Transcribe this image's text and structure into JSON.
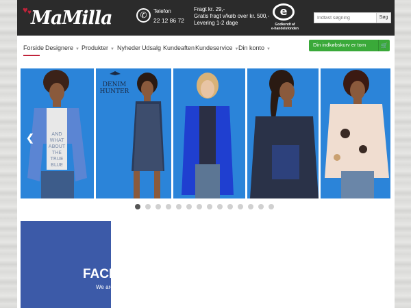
{
  "brand": {
    "name": "MaMilla"
  },
  "contact": {
    "phone_label": "Telefon",
    "phone_number": "22 12 86 72"
  },
  "shipping": {
    "line1": "Fragt kr. 29,-",
    "line2": "Gratis fragt v/køb over kr. 500,-",
    "line3": "Levering 1-2 dage"
  },
  "emaerke": {
    "letter": "e",
    "line1": "Godkendt af",
    "line2": "e-handelsfonden"
  },
  "search": {
    "placeholder": "Indtast søgning",
    "button_label": "Søg"
  },
  "nav": {
    "items": [
      {
        "label": "Forside",
        "dropdown": false
      },
      {
        "label": "Designere",
        "dropdown": true
      },
      {
        "label": "Produkter",
        "dropdown": true
      },
      {
        "label": "Nyheder",
        "dropdown": false
      },
      {
        "label": "Udsalg",
        "dropdown": false
      },
      {
        "label": "Kundeaften",
        "dropdown": false
      },
      {
        "label": "Kundeservice",
        "dropdown": true
      },
      {
        "label": "Din konto",
        "dropdown": true
      }
    ],
    "cart_label": "Din indkøbskurv er tom"
  },
  "slider": {
    "brand_text_line1": "DENIM",
    "brand_text_line2": "HUNTER",
    "shirt_text": [
      "AND",
      "WHAT",
      "ABOUT",
      "THE",
      "TRUE",
      "BLUE"
    ],
    "slide_count": 5,
    "dot_count": 14,
    "active_dot": 0
  },
  "facebook": {
    "title": "FACEBOOK",
    "subtitle": "We are"
  },
  "colors": {
    "header_bg": "#2b2b2b",
    "accent_red": "#c0233a",
    "cart_green": "#3aa939",
    "slide_blue": "#2b84d9",
    "facebook_blue": "#3c5aa8"
  },
  "icons": {
    "phone": "phone-icon",
    "cart": "shopping-cart-icon",
    "arrow": "chevron-left-icon",
    "caret": "caret-down-icon"
  }
}
